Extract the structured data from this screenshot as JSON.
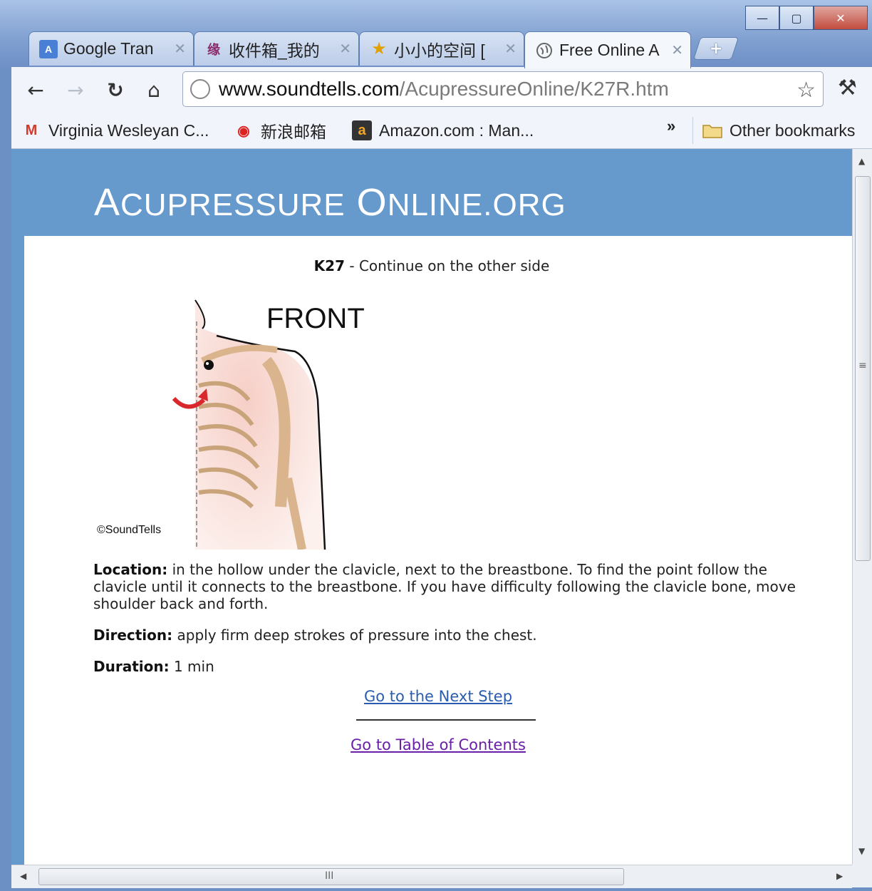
{
  "window": {
    "minimize_label": "—",
    "maximize_label": "▢",
    "close_label": "✕"
  },
  "tabs": [
    {
      "title": "Google Tran",
      "icon": "translate-icon",
      "active": false
    },
    {
      "title": "收件箱_我的",
      "icon": "mail-icon",
      "active": false
    },
    {
      "title": "小小的空间 [",
      "icon": "star-icon",
      "active": false
    },
    {
      "title": "Free Online A",
      "icon": "globe-icon",
      "active": true
    }
  ],
  "new_tab_label": "+",
  "toolbar": {
    "back": "←",
    "forward": "→",
    "reload": "↻",
    "home": "⌂",
    "url_host": "www.soundtells.com",
    "url_path": "/AcupressureOnline/K27R.htm",
    "bookmark_star": "☆",
    "wrench": "⚒"
  },
  "bookmarks": {
    "items": [
      {
        "label": "Virginia Wesleyan C...",
        "icon": "gmail-icon",
        "glyph": "M"
      },
      {
        "label": "新浪邮箱",
        "icon": "weibo-icon",
        "glyph": "◉"
      },
      {
        "label": "Amazon.com : Man...",
        "icon": "amazon-icon",
        "glyph": "a"
      }
    ],
    "overflow": "»",
    "other": "Other bookmarks"
  },
  "site": {
    "logo_a": "A",
    "logo_cupressure": "CUPRESSURE",
    "logo_o": "O",
    "logo_nline": "NLINE",
    "logo_org": ".ORG"
  },
  "step": {
    "code": "K27",
    "title_rest": " - Continue on the other side"
  },
  "illustration": {
    "label": "FRONT",
    "copyright": "©SoundTells"
  },
  "details": {
    "location_label": "Location:",
    "location_text": " in the hollow under the clavicle, next to the breastbone. To find the point follow the clavicle until it connects to the breastbone. If you have difficulty following the clavicle bone, move shoulder back and forth.",
    "direction_label": "Direction:",
    "direction_text": " apply firm deep strokes of pressure into the chest.",
    "duration_label": "Duration:",
    "duration_text": " 1 min"
  },
  "links": {
    "next": "Go to the Next Step",
    "toc": "Go to Table of Contents"
  },
  "scroll": {
    "v_grip": "≡",
    "h_grip": "III",
    "up": "▲",
    "down": "▼",
    "left": "◀",
    "right": "▶"
  }
}
